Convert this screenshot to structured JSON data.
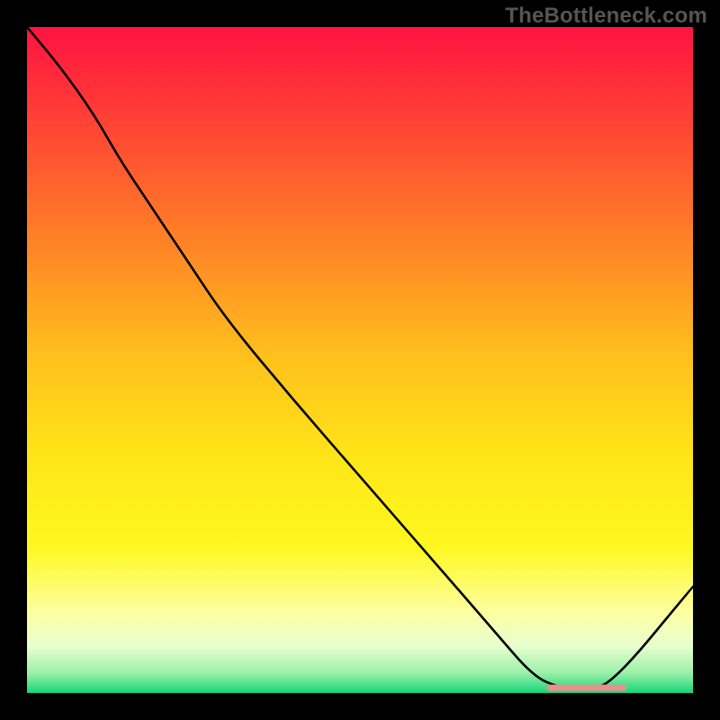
{
  "watermark": "TheBottleneck.com",
  "chart_data": {
    "type": "line",
    "title": "",
    "xlabel": "",
    "ylabel": "",
    "xlim": [
      0,
      100
    ],
    "ylim": [
      0,
      100
    ],
    "grid": false,
    "legend": false,
    "series": [
      {
        "name": "bottleneck-curve",
        "x": [
          0,
          5,
          10,
          14,
          18,
          22,
          24,
          30,
          40,
          50,
          60,
          70,
          76,
          80,
          84,
          88,
          100
        ],
        "y": [
          100,
          94,
          87,
          80,
          74,
          68,
          65,
          56,
          44,
          32.5,
          21,
          9.5,
          2.5,
          0.8,
          0.5,
          1.5,
          16
        ],
        "color": "#000000"
      }
    ],
    "optimal_marker": {
      "x_start": 78,
      "x_end": 90,
      "y": 0.8,
      "color": "#e9908f"
    },
    "background_gradient": {
      "stops": [
        {
          "pos": 0.0,
          "color": "#ff1242"
        },
        {
          "pos": 0.12,
          "color": "#ff3a36"
        },
        {
          "pos": 0.3,
          "color": "#ff7a28"
        },
        {
          "pos": 0.5,
          "color": "#ffc21c"
        },
        {
          "pos": 0.65,
          "color": "#ffe617"
        },
        {
          "pos": 0.78,
          "color": "#fff81f"
        },
        {
          "pos": 0.88,
          "color": "#fdffa2"
        },
        {
          "pos": 0.93,
          "color": "#e7ffcf"
        },
        {
          "pos": 0.97,
          "color": "#9af0a8"
        },
        {
          "pos": 1.0,
          "color": "#15d67a"
        }
      ]
    }
  }
}
